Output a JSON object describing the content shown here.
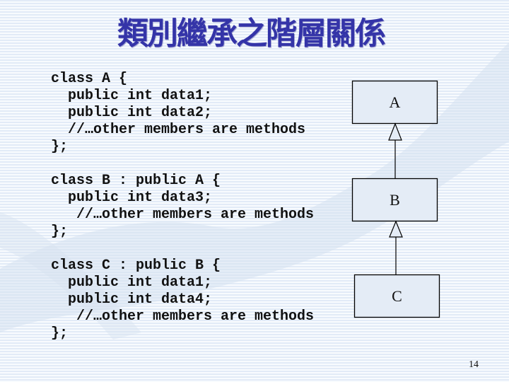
{
  "slide": {
    "title": "類別繼承之階層關係",
    "page_number": "14"
  },
  "code_blocks": [
    {
      "class": "A",
      "lines": [
        "class A {",
        "  public int data1;",
        "  public int data2;",
        "  //…other members are methods",
        "};"
      ]
    },
    {
      "class": "B",
      "lines": [
        "class B : public A {",
        "  public int data3;",
        "   //…other members are methods",
        "};"
      ]
    },
    {
      "class": "C",
      "lines": [
        "class C : public B {",
        "  public int data1;",
        "  public int data4;",
        "   //…other members are methods",
        "};"
      ]
    }
  ],
  "diagram": {
    "nodes": [
      {
        "id": "A",
        "label": "A"
      },
      {
        "id": "B",
        "label": "B"
      },
      {
        "id": "C",
        "label": "C"
      }
    ],
    "edges": [
      {
        "from": "B",
        "to": "A",
        "type": "inheritance"
      },
      {
        "from": "C",
        "to": "B",
        "type": "inheritance"
      }
    ]
  },
  "colors": {
    "title": "#3434a8",
    "box_fill": "#e4ecf6",
    "stroke": "#000000"
  }
}
